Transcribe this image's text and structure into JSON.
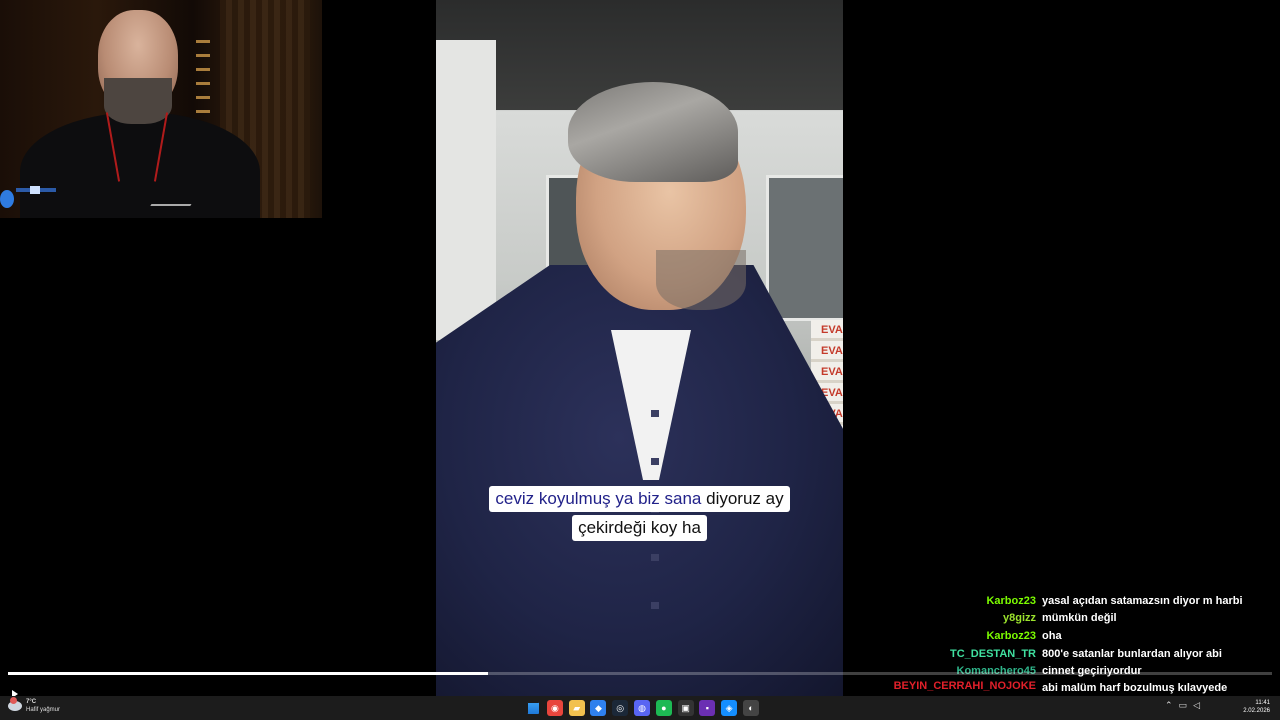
{
  "captions": {
    "line1_highlight": "ceviz koyulmuş ya biz sana",
    "line1_rest": " diyoruz ay",
    "line2": "çekirdeği koy ha"
  },
  "video_overlay": {
    "boxes_text": [
      "EVA",
      "EVA",
      "EVA",
      "EVA",
      "EVA",
      "EVA"
    ]
  },
  "chat": {
    "messages": [
      {
        "user": "Karboz23",
        "color": "#7cfc00",
        "text": "yasal açıdan satamazsın diyor m harbi"
      },
      {
        "user": "y8gizz",
        "color": "#9be22d",
        "text": "mümkün değil"
      },
      {
        "user": "Karboz23",
        "color": "#7cfc00",
        "text": "oha"
      },
      {
        "user": "TC_DESTAN_TR",
        "color": "#40e0a0",
        "text": "800'e satanlar bunlardan alıyor abi"
      },
      {
        "user": "Komanchero45",
        "color": "#2fb58a",
        "text": "cinnet geçiriyordur"
      },
      {
        "user": "BEYIN_CERRAHI_NOJOKE",
        "color": "#e0202a",
        "text": "abi malüm harf bozulmuş kılavyede \"analtıcı bilgi\" diyebiliyorum sadece şuan"
      }
    ]
  },
  "player": {
    "progress": 0.38
  },
  "taskbar": {
    "weather_temp": "7°C",
    "weather_desc": "Hafif yağmur",
    "time": "11:41",
    "date": "2.02.2026",
    "apps": [
      {
        "name": "chrome-icon",
        "glyph": "◉",
        "color": "#e8453c"
      },
      {
        "name": "folder-icon",
        "glyph": "▰",
        "color": "#f2c14e"
      },
      {
        "name": "store-icon",
        "glyph": "◆",
        "color": "#2f80ed"
      },
      {
        "name": "steam-icon",
        "glyph": "◎",
        "color": "#1b2838"
      },
      {
        "name": "discord-icon",
        "glyph": "◍",
        "color": "#5865f2"
      },
      {
        "name": "spotify-icon",
        "glyph": "●",
        "color": "#1db954"
      },
      {
        "name": "epic-icon",
        "glyph": "▣",
        "color": "#333333"
      },
      {
        "name": "kick-icon",
        "glyph": "▪",
        "color": "#6b2fb3"
      },
      {
        "name": "battlenet-icon",
        "glyph": "◈",
        "color": "#148eff"
      },
      {
        "name": "obs-icon",
        "glyph": "◐",
        "color": "#444444"
      }
    ]
  }
}
